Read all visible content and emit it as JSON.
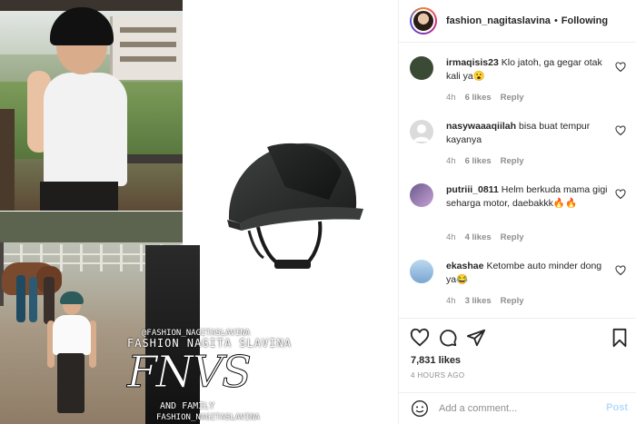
{
  "post": {
    "username": "fashion_nagitaslavina",
    "separator": "•",
    "follow_status": "Following",
    "likes": "7,831 likes",
    "time_ago": "4 HOURS AGO"
  },
  "watermark": {
    "handle_top": "@FASHION_NAGITASLAVINA",
    "name": "FASHION NAGITA SLAVINA",
    "monogram": "FNVS",
    "family": "AND FAMILY",
    "handle_bottom": "FASHION_NAGITASLAVINA"
  },
  "comments": [
    {
      "user": "irmaqisis23",
      "text": "Klo jatoh, ga gegar otak kali ya😮",
      "age": "4h",
      "likes": "6 likes",
      "reply": "Reply",
      "avatar_color": "#3b4a35"
    },
    {
      "user": "nasywaaaqiilah",
      "text": "bisa buat tempur kayanya",
      "age": "4h",
      "likes": "6 likes",
      "reply": "Reply",
      "avatar_color": "#dbdbdb"
    },
    {
      "user": "putriii_0811",
      "text": "Helm berkuda mama gigi seharga motor, daebakkk🔥🔥",
      "age": "4h",
      "likes": "4 likes",
      "reply": "Reply",
      "avatar_color": "#6a5a8c"
    },
    {
      "user": "ekashae",
      "text": "Ketombe auto minder dong ya😂",
      "age": "4h",
      "likes": "3 likes",
      "reply": "Reply",
      "avatar_color": "#9ec3e6"
    }
  ],
  "add_comment": {
    "placeholder": "Add a comment...",
    "post_label": "Post"
  },
  "icons": {
    "like": "heart-icon",
    "comment": "comment-icon",
    "share": "share-icon",
    "save": "bookmark-icon",
    "emoji": "emoji-icon"
  },
  "colors": {
    "text": "#262626",
    "muted": "#8e8e8e",
    "post_disabled": "#b3dbff",
    "divider": "#efefef"
  }
}
